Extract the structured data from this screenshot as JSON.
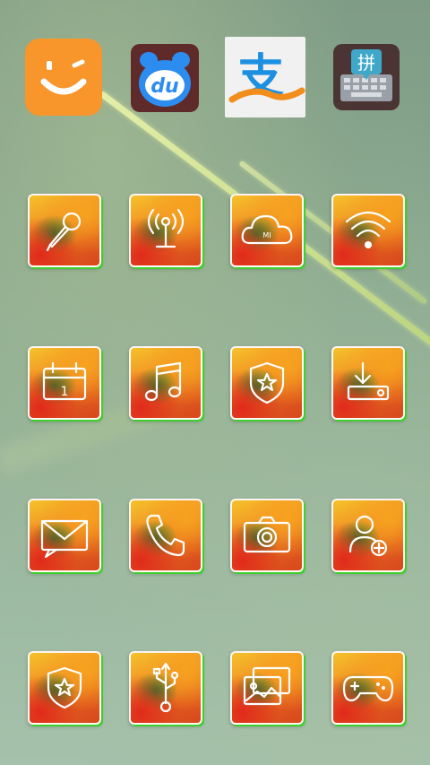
{
  "screen": {
    "type": "android-home-screen"
  },
  "top_row": [
    {
      "name": "smiley-app-icon",
      "color": "#f8962c"
    },
    {
      "name": "baidu-app-icon",
      "label": "du",
      "color": "#2d8cf0"
    },
    {
      "name": "alipay-app-icon",
      "label": "支",
      "color": "#1b8fe0"
    },
    {
      "name": "pinyin-keyboard-icon",
      "label": "拼",
      "color": "#3fa8c8"
    }
  ],
  "tiles": [
    {
      "name": "microphone-icon"
    },
    {
      "name": "broadcast-tower-icon"
    },
    {
      "name": "mi-cloud-icon",
      "label": "MI"
    },
    {
      "name": "wifi-icon"
    },
    {
      "name": "calendar-icon",
      "label": "1"
    },
    {
      "name": "music-note-icon"
    },
    {
      "name": "shield-star-icon"
    },
    {
      "name": "download-icon"
    },
    {
      "name": "mail-icon"
    },
    {
      "name": "phone-icon"
    },
    {
      "name": "camera-icon"
    },
    {
      "name": "add-contact-icon"
    },
    {
      "name": "security-shield-icon"
    },
    {
      "name": "usb-icon"
    },
    {
      "name": "gallery-icon"
    },
    {
      "name": "gamepad-icon"
    }
  ]
}
